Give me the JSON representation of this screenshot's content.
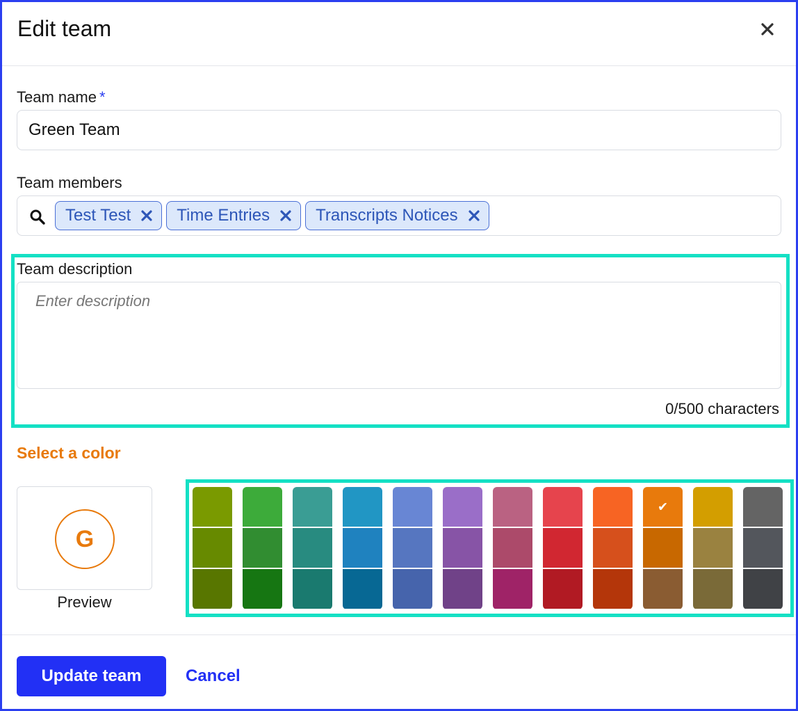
{
  "dialog": {
    "title": "Edit team",
    "close_icon": "close-icon"
  },
  "team_name": {
    "label": "Team name",
    "required_mark": "*",
    "value": "Green Team"
  },
  "team_members": {
    "label": "Team members",
    "search_icon": "search-icon",
    "chips": [
      {
        "label": "Test Test"
      },
      {
        "label": "Time Entries"
      },
      {
        "label": "Transcripts Notices"
      }
    ]
  },
  "team_description": {
    "label": "Team description",
    "placeholder": "Enter description",
    "value": "",
    "char_count": "0/500 characters"
  },
  "color": {
    "title": "Select a color",
    "preview_letter": "G",
    "preview_color": "#e87a0c",
    "preview_label": "Preview",
    "selected": "#e87a0c",
    "palette": [
      [
        "#7a9a00",
        "#678a00",
        "#587600"
      ],
      [
        "#3dab3a",
        "#318d31",
        "#167612"
      ],
      [
        "#3a9d94",
        "#288b80",
        "#1a7a6f"
      ],
      [
        "#2196c4",
        "#1f82bf",
        "#076894"
      ],
      [
        "#6886d4",
        "#5676c0",
        "#4664ac"
      ],
      [
        "#9a6ec8",
        "#8754a6",
        "#704288"
      ],
      [
        "#ba6282",
        "#ac4a6a",
        "#9f2367"
      ],
      [
        "#e6444d",
        "#d12731",
        "#b11a23"
      ],
      [
        "#f76423",
        "#d6501c",
        "#b4360a"
      ],
      [
        "#e87a0c",
        "#c86800",
        "#8a5c32"
      ],
      [
        "#d39e00",
        "#9a8240",
        "#7a6a38"
      ],
      [
        "#646464",
        "#53565c",
        "#404246"
      ]
    ]
  },
  "footer": {
    "primary_label": "Update team",
    "cancel_label": "Cancel"
  }
}
